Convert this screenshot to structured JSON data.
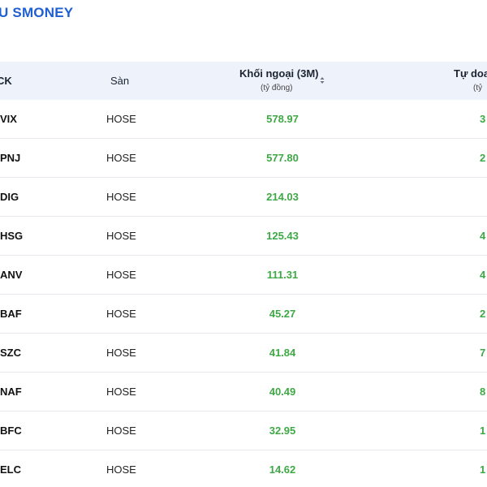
{
  "brand": {
    "text": "U SMONEY",
    "color": "#1f5fd1"
  },
  "table": {
    "headers": {
      "ticker": "CK",
      "exchange": "Sàn",
      "foreign_title": "Khối ngoại (3M)",
      "foreign_unit": "(tỷ đồng)",
      "self_title": "Tự doa",
      "self_unit": "(tỷ"
    },
    "rows": [
      {
        "ticker": "VIX",
        "exchange": "HOSE",
        "foreign": "578.97",
        "self": "3"
      },
      {
        "ticker": "PNJ",
        "exchange": "HOSE",
        "foreign": "577.80",
        "self": "2"
      },
      {
        "ticker": "DIG",
        "exchange": "HOSE",
        "foreign": "214.03",
        "self": ""
      },
      {
        "ticker": "HSG",
        "exchange": "HOSE",
        "foreign": "125.43",
        "self": "4"
      },
      {
        "ticker": "ANV",
        "exchange": "HOSE",
        "foreign": "111.31",
        "self": "4"
      },
      {
        "ticker": "BAF",
        "exchange": "HOSE",
        "foreign": "45.27",
        "self": "2"
      },
      {
        "ticker": "SZC",
        "exchange": "HOSE",
        "foreign": "41.84",
        "self": "7"
      },
      {
        "ticker": "NAF",
        "exchange": "HOSE",
        "foreign": "40.49",
        "self": "8"
      },
      {
        "ticker": "BFC",
        "exchange": "HOSE",
        "foreign": "32.95",
        "self": "1"
      },
      {
        "ticker": "ELC",
        "exchange": "HOSE",
        "foreign": "14.62",
        "self": "1"
      }
    ]
  },
  "colors": {
    "header_bg": "#edf2fb",
    "positive": "#3ea845"
  },
  "icons": {
    "sort": "sort-updown-icon"
  }
}
